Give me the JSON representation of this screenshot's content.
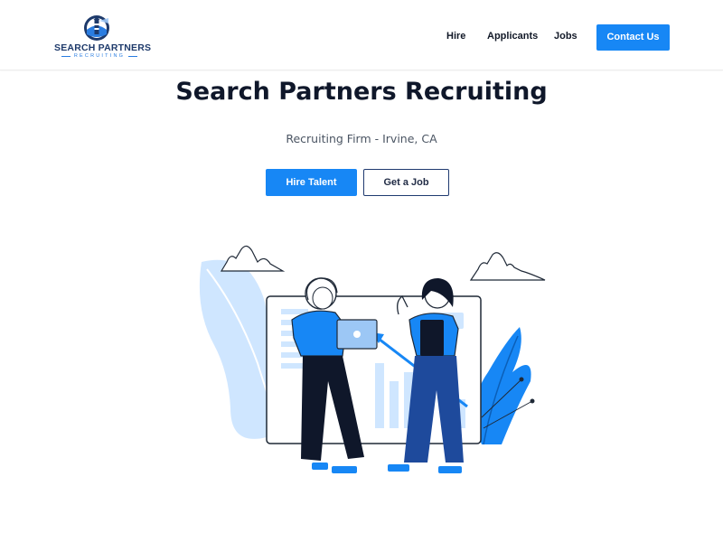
{
  "header": {
    "logo": {
      "name": "SEARCH PARTNERS",
      "sub": "RECRUITING",
      "icon": "lighthouse-logo-icon"
    },
    "nav": [
      {
        "label": "Hire"
      },
      {
        "label": "Applicants"
      },
      {
        "label": "Jobs"
      }
    ],
    "contact_label": "Contact Us"
  },
  "hero": {
    "title": "Search Partners Recruiting",
    "subtitle": "Recruiting Firm - Irvine, CA",
    "primary_button": "Hire Talent",
    "secondary_button": "Get a Job"
  },
  "illustration": {
    "icon": "two-women-dashboard-illustration"
  },
  "colors": {
    "accent": "#1787f5",
    "navy": "#1e3a6b",
    "light_blue": "#b9dcff",
    "text": "#111827"
  }
}
